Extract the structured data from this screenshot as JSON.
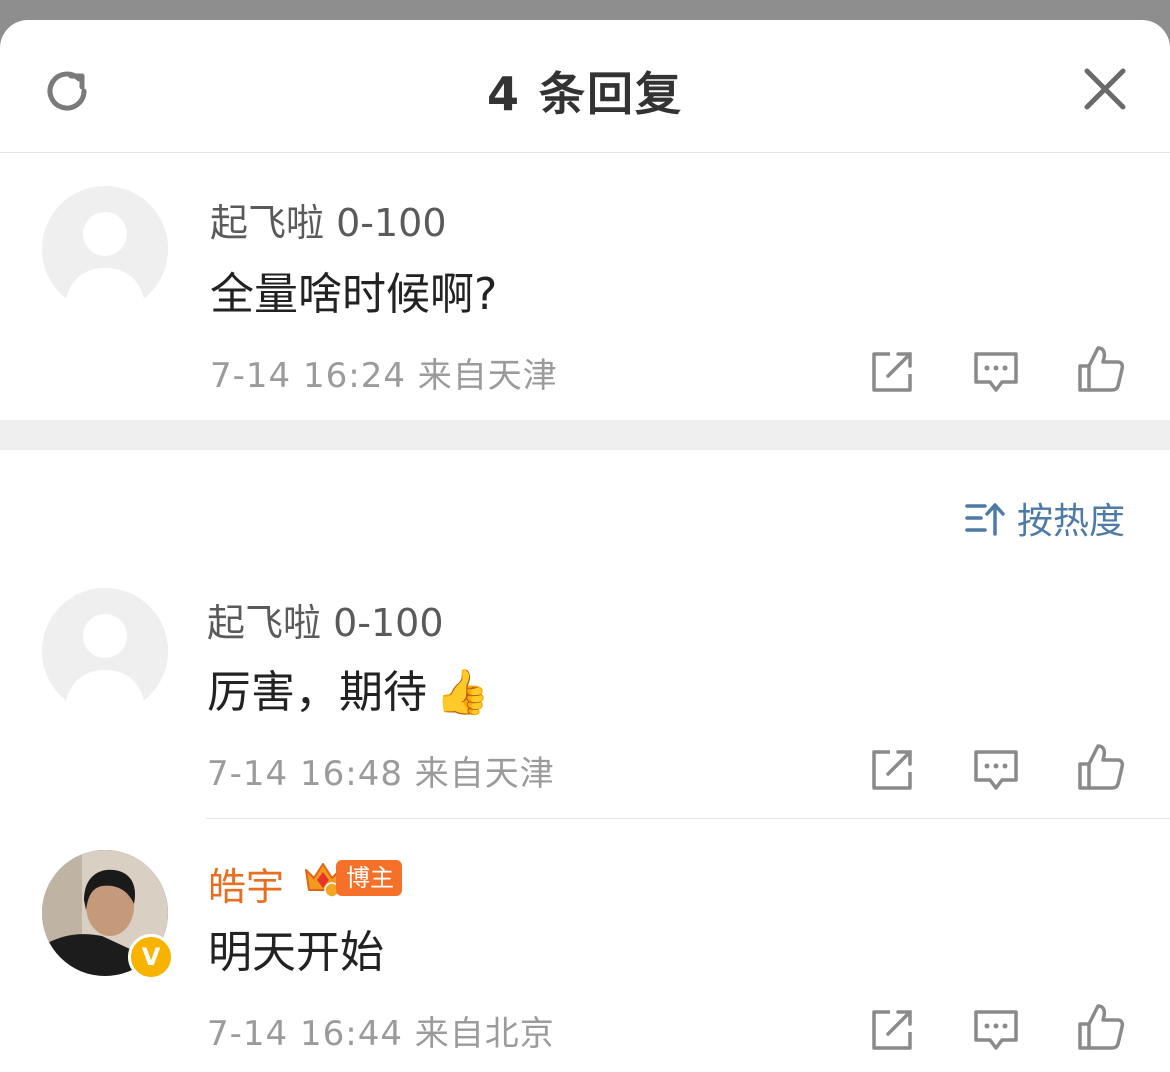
{
  "header": {
    "title": "4 条回复"
  },
  "sort": {
    "label": "按热度"
  },
  "comments": [
    {
      "username": "起飞啦 0-100",
      "content": "全量啥时候啊?",
      "time": "7-14 16:24",
      "location": "来自天津"
    },
    {
      "username": "起飞啦 0-100",
      "content": "厉害，期待",
      "emoji": "👍",
      "time": "7-14 16:48",
      "location": "来自天津"
    },
    {
      "username": "皓宇",
      "badge": "博主",
      "content": "明天开始",
      "time": "7-14 16:44",
      "location": "来自北京"
    }
  ],
  "icons": {
    "refresh": "refresh-icon",
    "close": "close-icon",
    "share": "share-icon",
    "reply": "comment-icon",
    "like": "thumbs-up-icon",
    "sort": "sort-icon",
    "verified": "verified-icon",
    "crown": "crown-icon"
  },
  "colors": {
    "owner_name": "#e86f1f",
    "link": "#4e7aa6",
    "verified": "#f8b200",
    "badge": "#f5712a"
  }
}
